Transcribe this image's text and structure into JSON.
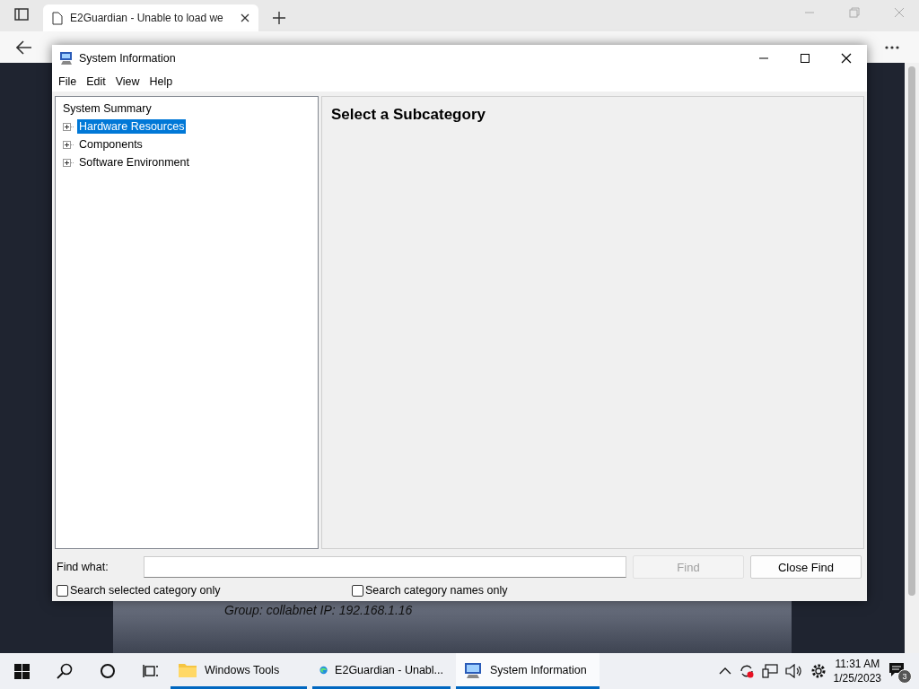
{
  "browser": {
    "tab_title": "E2Guardian - Unable to load we",
    "page_text": "Group: collabnet   IP: 192.168.1.16"
  },
  "window": {
    "title": "System Information",
    "menu": [
      "File",
      "Edit",
      "View",
      "Help"
    ],
    "tree": [
      {
        "label": "System Summary",
        "selected": false,
        "children": [
          {
            "label": "Hardware Resources",
            "selected": true,
            "expanded": false
          },
          {
            "label": "Components",
            "selected": false,
            "expanded": false
          },
          {
            "label": "Software Environment",
            "selected": false,
            "expanded": false
          }
        ]
      }
    ],
    "heading": "Select a Subcategory",
    "find": {
      "label": "Find what:",
      "buttons": [
        {
          "label": "Find",
          "disabled": true
        },
        {
          "label": "Close Find",
          "disabled": false
        }
      ],
      "checkboxes": [
        {
          "label": "Search selected category only",
          "checked": false
        },
        {
          "label": "Search category names only",
          "checked": false
        }
      ]
    }
  },
  "taskbar": {
    "apps": [
      {
        "label": "Windows Tools",
        "kind": "folder",
        "selected": false
      },
      {
        "label": "E2Guardian - Unabl...",
        "kind": "browser",
        "selected": false
      },
      {
        "label": "System Information",
        "kind": "sysinfo",
        "selected": true
      }
    ],
    "time": "11:31 AM",
    "date": "1/25/2023",
    "notifications": "3"
  }
}
